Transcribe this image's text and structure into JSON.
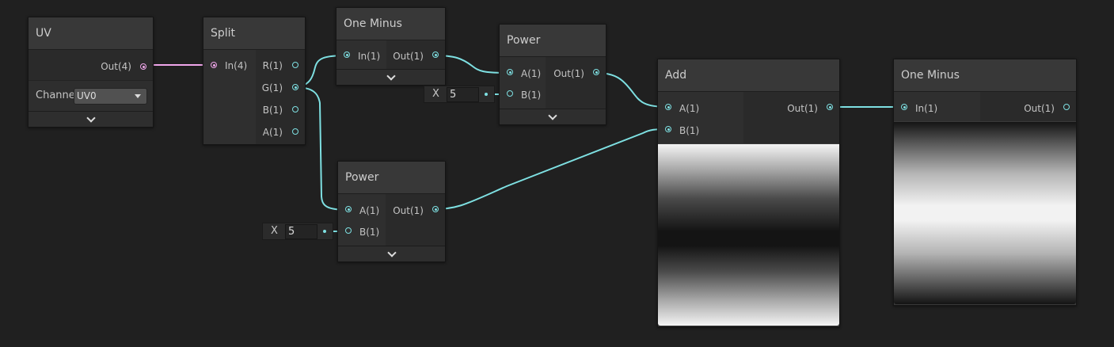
{
  "nodes": {
    "uv": {
      "title": "UV",
      "out": "Out(4)",
      "channel_label": "Channe",
      "channel_value": "UV0"
    },
    "split": {
      "title": "Split",
      "in": "In(4)",
      "outs": [
        "R(1)",
        "G(1)",
        "B(1)",
        "A(1)"
      ]
    },
    "one_minus_1": {
      "title": "One Minus",
      "in": "In(1)",
      "out": "Out(1)"
    },
    "power_top": {
      "title": "Power",
      "in_a": "A(1)",
      "in_b": "B(1)",
      "out": "Out(1)",
      "b_label": "X",
      "b_value": "5"
    },
    "power_bottom": {
      "title": "Power",
      "in_a": "A(1)",
      "in_b": "B(1)",
      "out": "Out(1)",
      "b_label": "X",
      "b_value": "5"
    },
    "add": {
      "title": "Add",
      "in_a": "A(1)",
      "in_b": "B(1)",
      "out": "Out(1)"
    },
    "one_minus_2": {
      "title": "One Minus",
      "in": "In(1)",
      "out": "Out(1)"
    }
  },
  "colors": {
    "background": "#202020",
    "float_wire": "#7ee0e2",
    "vector4_wire": "#f0a6ea",
    "node_body": "#393939"
  }
}
